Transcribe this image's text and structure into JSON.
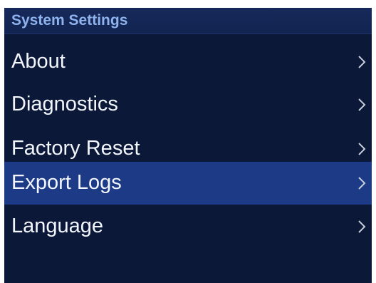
{
  "header": {
    "title": "System Settings"
  },
  "menu": {
    "items": [
      {
        "label": "About",
        "icon": "chevron-right-icon",
        "selected": false
      },
      {
        "label": "Diagnostics",
        "icon": "chevron-right-icon",
        "selected": false
      },
      {
        "label": "Factory Reset",
        "icon": "chevron-right-icon",
        "selected": false
      },
      {
        "label": "Export Logs",
        "icon": "chevron-right-icon",
        "selected": true
      },
      {
        "label": "Language",
        "icon": "chevron-right-icon",
        "selected": false
      }
    ]
  },
  "colors": {
    "background": "#0b1838",
    "header_background": "#142752",
    "header_text": "#8fb3ee",
    "selected_row": "#1c3a86",
    "item_text": "#f2f5fb",
    "chevron": "#c8cfdc"
  }
}
